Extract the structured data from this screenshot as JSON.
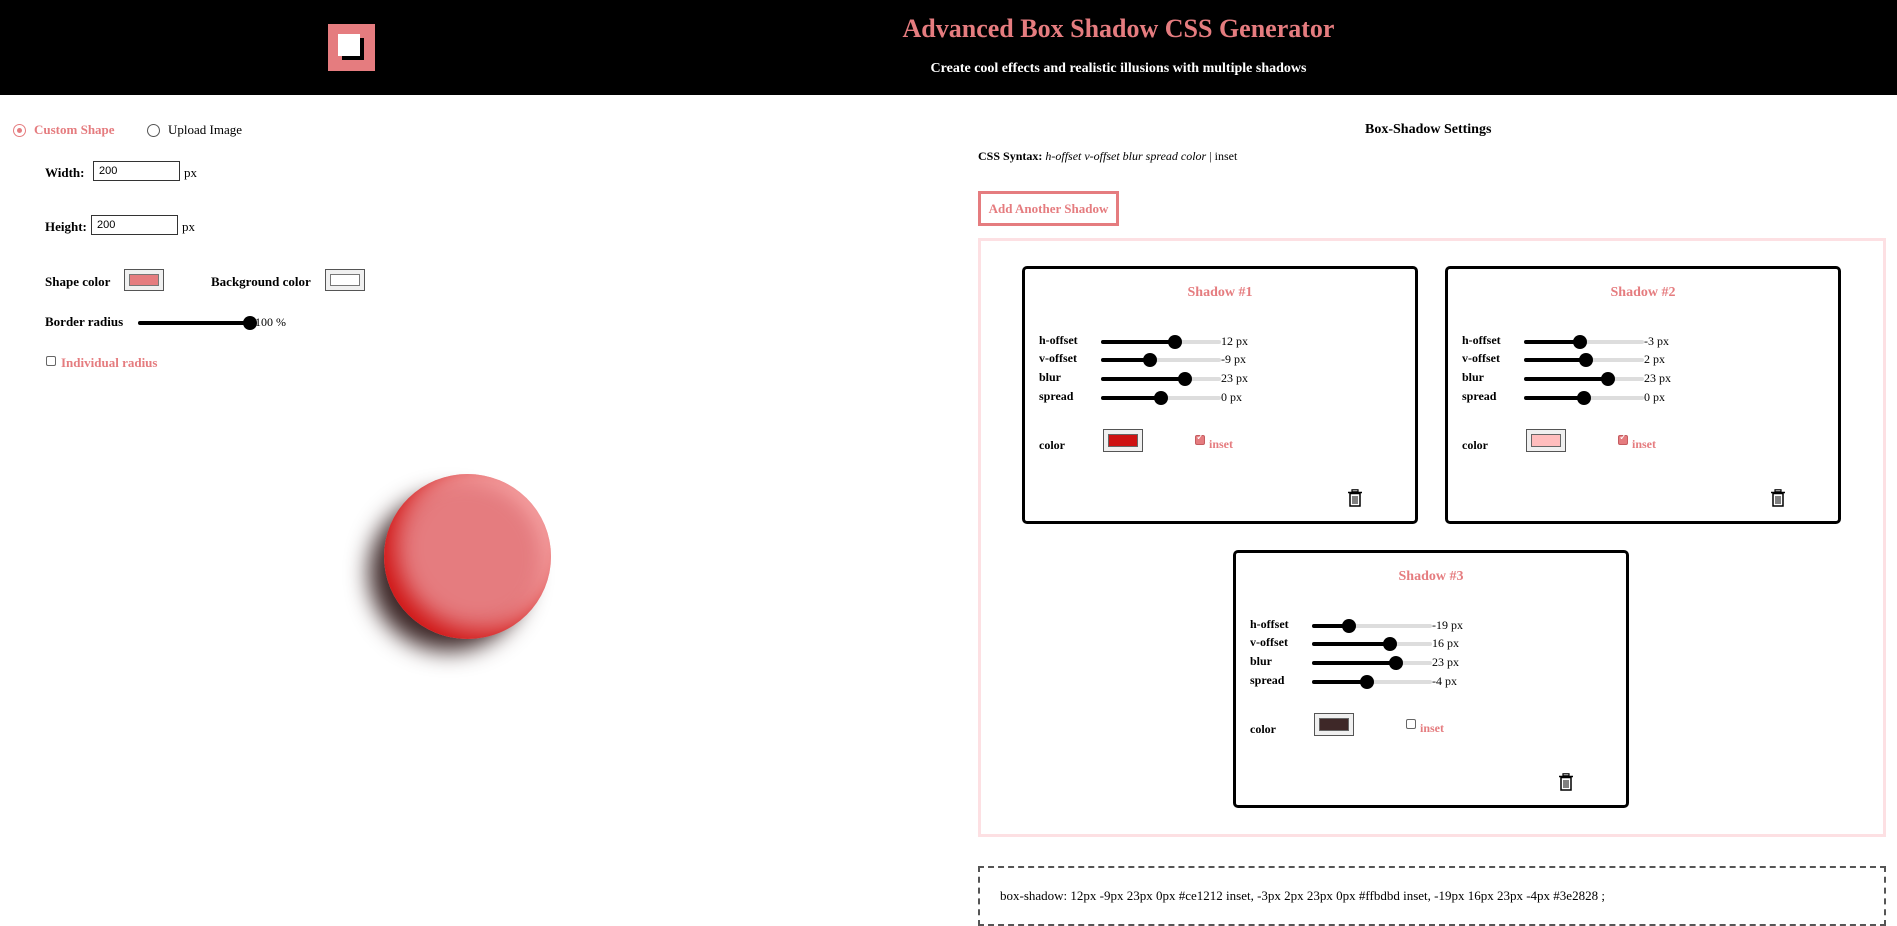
{
  "header": {
    "title": "Advanced Box Shadow CSS Generator",
    "subtitle": "Create cool effects and realistic illusions with multiple shadows"
  },
  "mode": {
    "custom_shape_label": "Custom Shape",
    "upload_image_label": "Upload Image",
    "selected": "Custom Shape"
  },
  "shape": {
    "width_label": "Width:",
    "width_value": "200",
    "height_label": "Height:",
    "height_value": "200",
    "unit": "px",
    "shape_color_label": "Shape color",
    "shape_color": "#e57c7f",
    "background_color_label": "Background color",
    "background_color": "#ffffff",
    "border_radius_label": "Border radius",
    "border_radius_value": "100 %",
    "border_radius_fraction": 1.0,
    "individual_radius_label": "Individual radius",
    "individual_radius_checked": false
  },
  "settings": {
    "title": "Box-Shadow Settings",
    "syntax_label": "CSS Syntax:",
    "syntax_italic": "h-offset v-offset blur spread color",
    "syntax_sep": " | ",
    "syntax_rest": "inset",
    "add_button_label": "Add Another Shadow"
  },
  "shadows": [
    {
      "title": "Shadow #1",
      "h_offset": "12 px",
      "h_fraction": 0.62,
      "v_offset": "-9 px",
      "v_fraction": 0.41,
      "blur": "23 px",
      "blur_fraction": 0.7,
      "spread": "0 px",
      "spread_fraction": 0.5,
      "color_label": "color",
      "color": "#ce1212",
      "inset_label": "inset",
      "inset": true
    },
    {
      "title": "Shadow #2",
      "h_offset": "-3 px",
      "h_fraction": 0.47,
      "v_offset": "2 px",
      "v_fraction": 0.52,
      "blur": "23 px",
      "blur_fraction": 0.7,
      "spread": "0 px",
      "spread_fraction": 0.5,
      "color_label": "color",
      "color": "#ffbdbd",
      "inset_label": "inset",
      "inset": true
    },
    {
      "title": "Shadow #3",
      "h_offset": "-19 px",
      "h_fraction": 0.31,
      "v_offset": "16 px",
      "v_fraction": 0.65,
      "blur": "23 px",
      "blur_fraction": 0.7,
      "spread": "-4 px",
      "spread_fraction": 0.46,
      "color_label": "color",
      "color": "#3e2828",
      "inset_label": "inset",
      "inset": false
    }
  ],
  "labels": {
    "h_offset": "h-offset",
    "v_offset": "v-offset",
    "blur": "blur",
    "spread": "spread"
  },
  "output": {
    "css": "box-shadow: 12px -9px 23px 0px #ce1212 inset, -3px 2px 23px 0px #ffbdbd inset, -19px 16px 23px -4px #3e2828 ;"
  },
  "icons": {
    "logo": "logo-icon",
    "delete": "trash-icon"
  }
}
